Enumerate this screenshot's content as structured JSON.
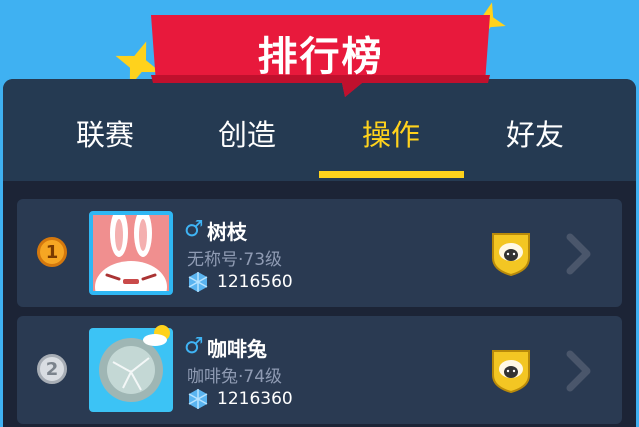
{
  "banner": {
    "title": "排行榜"
  },
  "tabs": [
    {
      "label": "联赛"
    },
    {
      "label": "创造"
    },
    {
      "label": "操作"
    },
    {
      "label": "好友"
    }
  ],
  "active_tab": "操作",
  "rows": [
    {
      "rank": "1",
      "gender": "♂",
      "name": "树枝",
      "subtitle": "无称号·73级",
      "score": "1216560"
    },
    {
      "rank": "2",
      "gender": "♂",
      "name": "咖啡兔",
      "subtitle": "咖啡兔·74级",
      "score": "1216360"
    }
  ],
  "colors": {
    "background": "#3fb1f2",
    "banner": "#e8193c",
    "accent": "#ffd21c",
    "gender": "#3fb4f5"
  }
}
